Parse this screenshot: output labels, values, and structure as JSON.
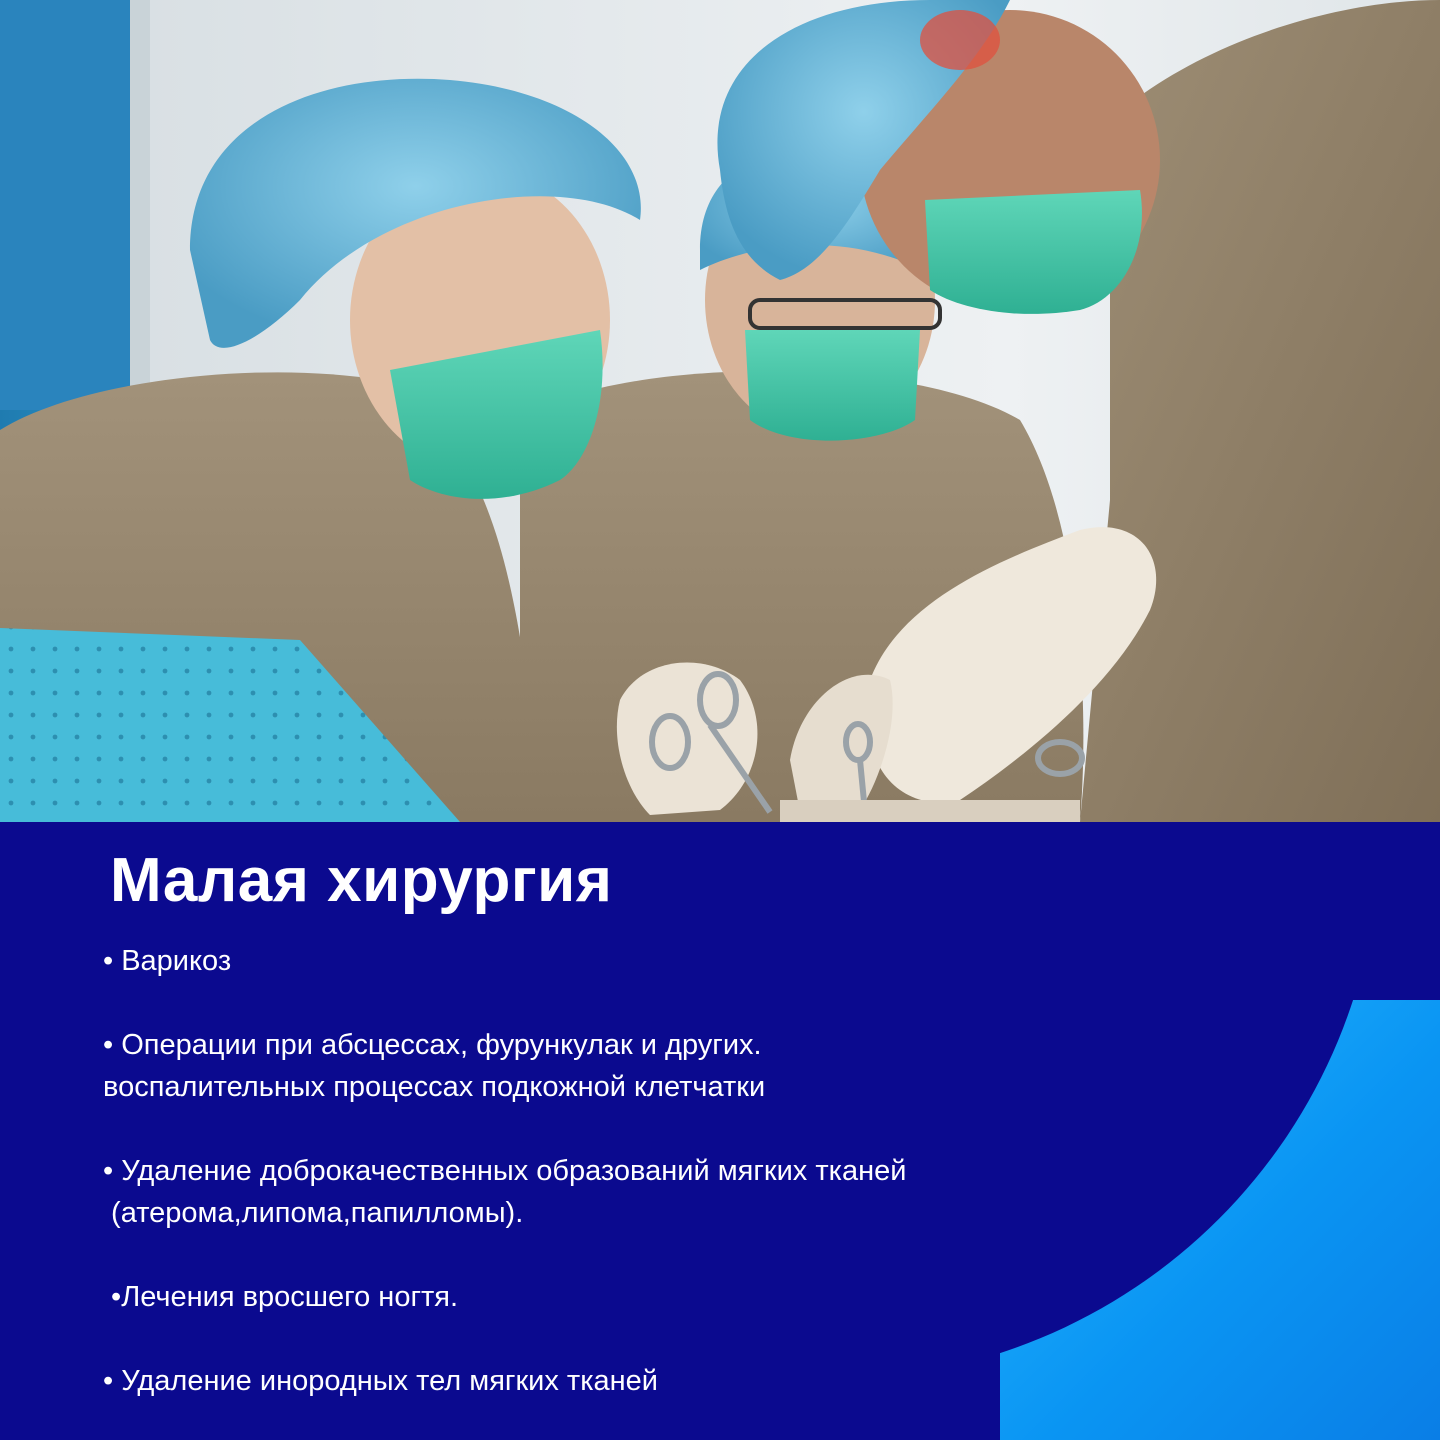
{
  "photo": {
    "icons": [
      "surgeon-team-photo"
    ],
    "colors": {
      "gown": "#9a8a70",
      "cap": "#5aaed2",
      "mask": "#39c6a5",
      "drape": "#3fb6d6",
      "wall": "#e8ecee"
    }
  },
  "panel": {
    "title": "Малая хирургия",
    "items": [
      {
        "lines": [
          "• Варикоз"
        ]
      },
      {
        "lines": [
          "• Операции при абсцессах, фурункулак и других.",
          "воспалительных процессах подкожной клетчатки"
        ]
      },
      {
        "lines": [
          "• Удаление доброкачественных образований мягких тканей",
          " (атерома,липома,папилломы)."
        ]
      },
      {
        "lines": [
          " •Лечения вросшего ногтя."
        ]
      },
      {
        "lines": [
          "• Удаление инородных тел мягких тканей"
        ]
      }
    ],
    "colors": {
      "background": "#0b0a8f",
      "text": "#ffffff",
      "accent": "#21b4ff"
    }
  }
}
